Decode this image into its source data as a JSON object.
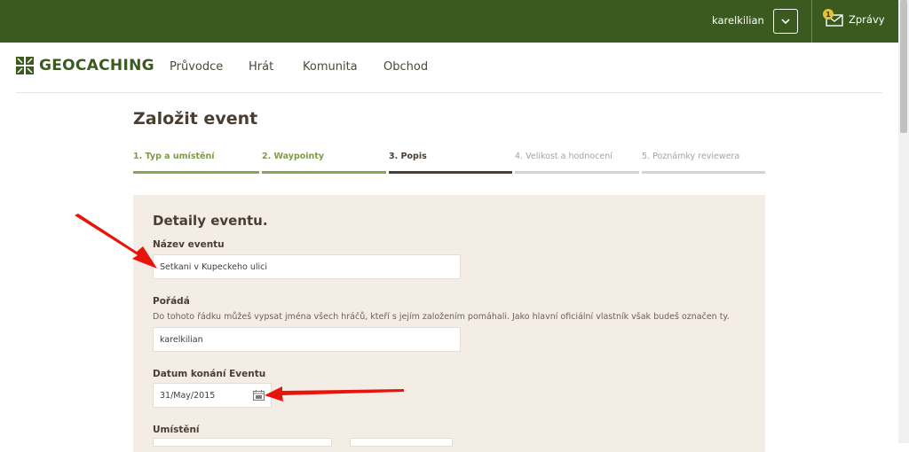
{
  "header": {
    "username": "karelkilian",
    "messages_label": "Zprávy",
    "messages_badge": "1"
  },
  "nav": {
    "logo_text": "GEOCACHING",
    "items": [
      "Průvodce",
      "Hrát",
      "Komunita",
      "Obchod"
    ]
  },
  "page": {
    "title": "Založit event"
  },
  "steps": [
    {
      "label": "1. Typ a umístění",
      "state": "done"
    },
    {
      "label": "2. Waypointy",
      "state": "done"
    },
    {
      "label": "3. Popis",
      "state": "active"
    },
    {
      "label": "4. Velikost a hodnocení",
      "state": "pending"
    },
    {
      "label": "5. Poznámky reviewera",
      "state": "pending"
    }
  ],
  "form": {
    "section_title": "Detaily eventu.",
    "name_label": "Název eventu",
    "name_value": "Setkani v Kupeckeho ulici",
    "organizer_label": "Pořádá",
    "organizer_help": "Do tohoto řádku můžeš vypsat jména všech hráčů, kteří s jejím založením pomáhali. Jako hlavní oficiální vlastník však budeš označen ty.",
    "organizer_value": "karelkilian",
    "date_label": "Datum konání Eventu",
    "date_value": "31/May/2015",
    "location_label": "Umístění"
  },
  "colors": {
    "brand_green": "#3a5a1f",
    "done_step": "#8aa45a",
    "active_step": "#4a3e32",
    "pending_step": "#d6d3cf",
    "panel_bg": "#f4ede6",
    "annotation_red": "#e8140c"
  }
}
